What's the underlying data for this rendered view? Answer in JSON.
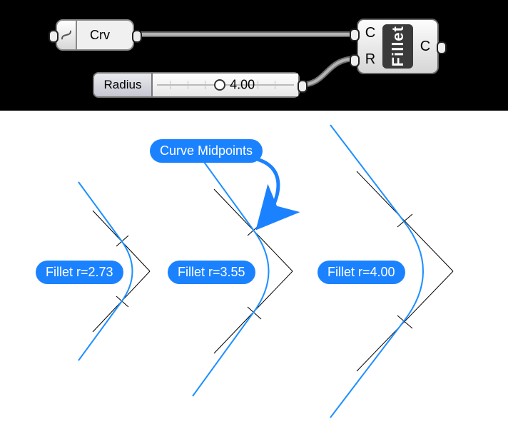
{
  "diagram_type": "visual-programming-nodes-and-geometry",
  "editor": {
    "crv_node_label": "Crv",
    "slider": {
      "name": "Radius",
      "value_text": "4.00",
      "knob_pos_pct": 46
    },
    "fillet": {
      "title": "Fillet",
      "input_labels": [
        "C",
        "R"
      ],
      "output_labels": [
        "C"
      ]
    }
  },
  "annotations": {
    "midpoints_label": "Curve Midpoints",
    "fillets": [
      {
        "label": "Fillet r=2.73",
        "radius": 2.73
      },
      {
        "label": "Fillet r=3.55",
        "radius": 3.55
      },
      {
        "label": "Fillet r=4.00",
        "radius": 4.0
      }
    ]
  },
  "chart_data": {
    "type": "diagram",
    "description": "Three pairs of lines meeting at a corner, each filleted with a different radius so the arc is tangent to both lines. Tick marks show the curve midpoints on each input line. Radii increase left→right.",
    "series": [
      {
        "name": "left",
        "fillet_radius": 2.73
      },
      {
        "name": "center",
        "fillet_radius": 3.55
      },
      {
        "name": "right",
        "fillet_radius": 4.0
      }
    ],
    "input_slider_radius": 4.0
  }
}
